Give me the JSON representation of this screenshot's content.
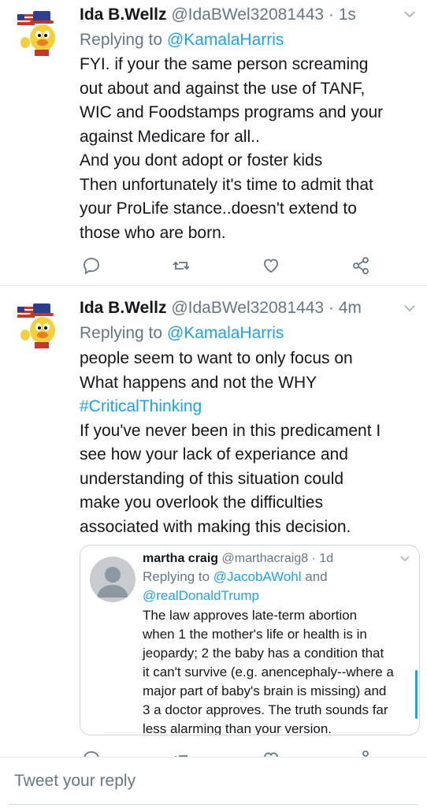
{
  "tweets": [
    {
      "name": "Ida B.Wellz",
      "handle": "@IdaBWel32081443",
      "sep": " · ",
      "time": "1s",
      "replying_prefix": "Replying to ",
      "replying_to": "@KamalaHarris",
      "lines": [
        "FYI. if your the same person screaming",
        "out about and against the use of TANF,",
        "WIC and Foodstamps programs and your",
        "against Medicare for all..",
        "And you dont adopt or foster kids",
        "Then unfortunately it's time to admit that",
        "your ProLife stance..doesn't extend to",
        "those who are born."
      ]
    },
    {
      "name": "Ida B.Wellz",
      "handle": "@IdaBWel32081443",
      "sep": " · ",
      "time": "4m",
      "replying_prefix": "Replying to ",
      "replying_to": "@KamalaHarris",
      "lines": [
        "people seem to want to only focus on",
        "What happens and not the WHY"
      ],
      "hashtag": "#CriticalThinking",
      "lines2": [
        "If you've never been in this predicament I",
        "see how your lack of experiance and",
        "understanding of this situation could",
        "make you overlook the difficulties",
        "associated with making this decision."
      ]
    }
  ],
  "quote": {
    "name": "martha craig",
    "handle": "@marthacraig8",
    "sep": " · ",
    "time": "1d",
    "replying_prefix": "Replying to ",
    "replying_to_1": "@JacobAWohl",
    "and": " and",
    "replying_to_2": "@realDonaldTrump",
    "lines": [
      "The law approves late-term abortion",
      "when 1 the mother's life or health is in",
      "jeopardy; 2 the baby has a condition that",
      "it can't survive (e.g. anencephaly--where a",
      "major part of baby's brain is missing) and",
      "3 a doctor approves. The truth sounds far",
      "less alarming than your version."
    ]
  },
  "reply_box": {
    "placeholder": "Tweet your reply"
  },
  "colors": {
    "link": "#1da1f2",
    "muted": "#657786",
    "text": "#14171a",
    "border": "#e1e8ed"
  },
  "icons": [
    "reply-icon",
    "retweet-icon",
    "like-icon",
    "share-icon",
    "chevron-down-icon"
  ]
}
